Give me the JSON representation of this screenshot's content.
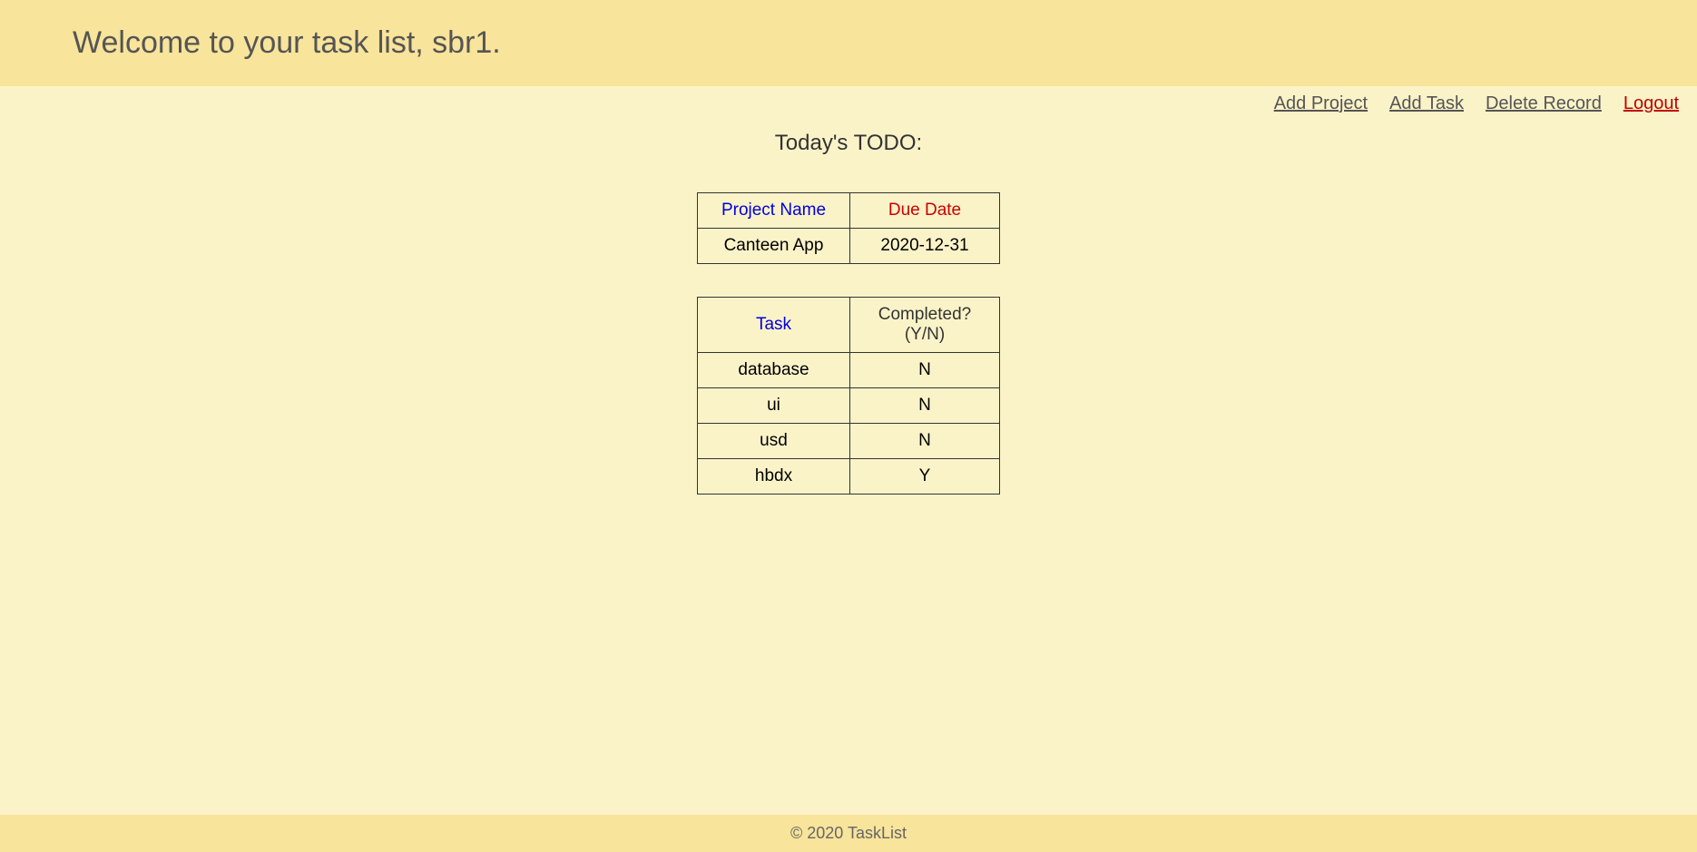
{
  "header": {
    "welcome": "Welcome to your task list, sbr1."
  },
  "nav": {
    "add_project": "Add Project",
    "add_task": "Add Task",
    "delete_record": "Delete Record",
    "logout": "Logout"
  },
  "main": {
    "todo_title": "Today's TODO:",
    "project_table": {
      "headers": {
        "project_name": "Project Name",
        "due_date": "Due Date"
      },
      "rows": [
        {
          "name": "Canteen App",
          "due": "2020-12-31"
        }
      ]
    },
    "task_table": {
      "headers": {
        "task": "Task",
        "completed": "Completed? (Y/N)"
      },
      "rows": [
        {
          "task": "database",
          "completed": "N"
        },
        {
          "task": "ui",
          "completed": "N"
        },
        {
          "task": "usd",
          "completed": "N"
        },
        {
          "task": "hbdx",
          "completed": "Y"
        }
      ]
    }
  },
  "footer": {
    "text": "© 2020 TaskList"
  }
}
